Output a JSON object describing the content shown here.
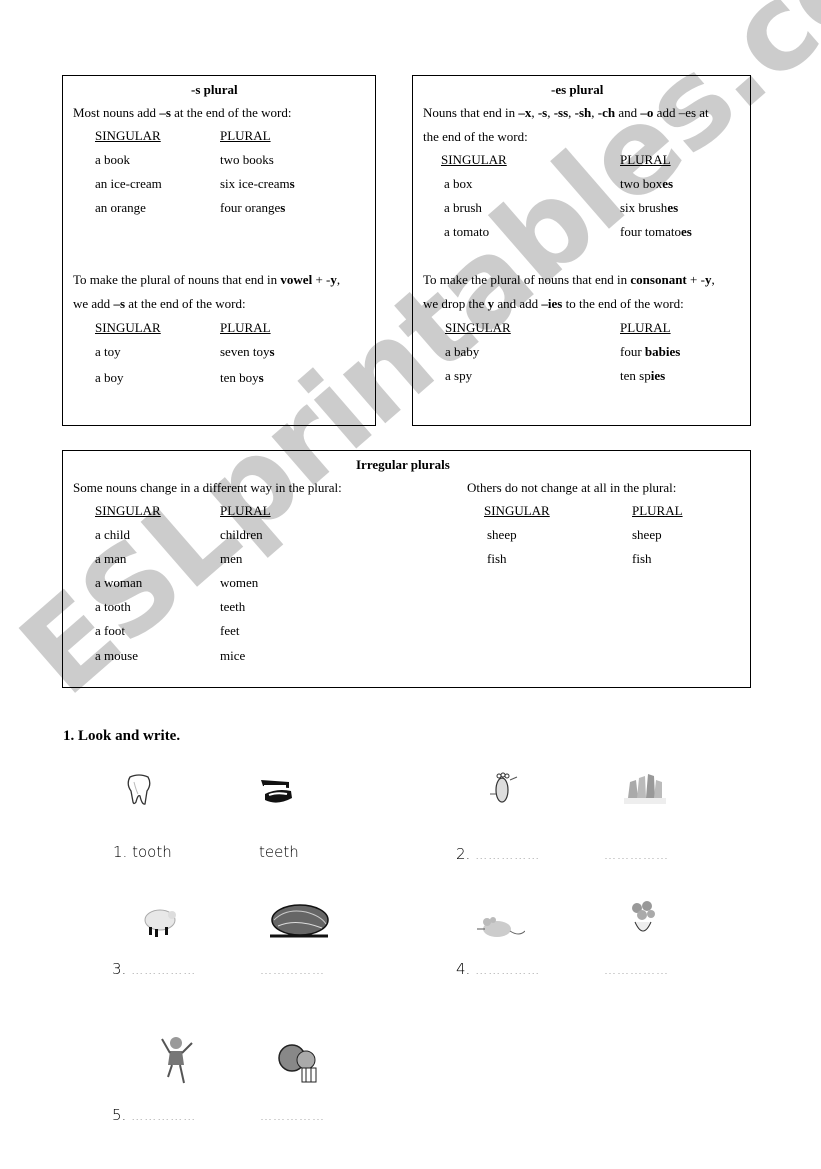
{
  "s_plural": {
    "title": "-s plural",
    "intro": [
      "Most nouns add ",
      "–s",
      " at the end of the word:"
    ],
    "headers": [
      "SINGULAR",
      "PLURAL"
    ],
    "rows": [
      {
        "singular": "a book",
        "plural_base": "two books",
        "plural_bold": ""
      },
      {
        "singular": "an ice-cream",
        "plural_base": "six ice-cream",
        "plural_bold": "s"
      },
      {
        "singular": "an orange",
        "plural_base": "four orange",
        "plural_bold": "s"
      }
    ],
    "rule2": {
      "line1": [
        "To make the plural of nouns that end in ",
        "vowel",
        " + -",
        "y",
        ","
      ],
      "line2": [
        "we add ",
        "–s",
        " at the end of the word:"
      ]
    },
    "rows2": [
      {
        "singular": "a toy",
        "plural_base": "seven toy",
        "plural_bold": "s"
      },
      {
        "singular": "a boy",
        "plural_base": "ten boy",
        "plural_bold": "s"
      }
    ]
  },
  "es_plural": {
    "title": "-es plural",
    "intro1": [
      "Nouns that end in ",
      "–x",
      ", ",
      "-s",
      ", ",
      "-ss",
      ", ",
      "-sh",
      ", ",
      "-ch",
      " and ",
      "–o",
      " add  –es at"
    ],
    "intro2": "the end of the word:",
    "headers": [
      "SINGULAR",
      "PLURAL"
    ],
    "rows": [
      {
        "singular": "a box",
        "plural_base": "two box",
        "plural_bold": "es"
      },
      {
        "singular": "a brush",
        "plural_base": "six brush",
        "plural_bold": "es"
      },
      {
        "singular": "a tomato",
        "plural_base": "four tomato",
        "plural_bold": "es"
      }
    ],
    "rule2": {
      "line1": [
        "To make the plural of nouns that end in ",
        "consonant",
        " + -",
        "y",
        ","
      ],
      "line2": [
        "we drop the ",
        "y",
        " and add ",
        "–ies",
        " to the end of the word:"
      ]
    },
    "rows2": [
      {
        "singular": "a baby",
        "plural_base": "four ",
        "plural_bold": "babies"
      },
      {
        "singular": "a spy",
        "plural_base": "ten sp",
        "plural_bold": "ies"
      }
    ]
  },
  "irregular": {
    "title": "Irregular plurals",
    "left_intro": "Some nouns change in a different way in the plural:",
    "right_intro": "Others do not change at all in the plural:",
    "headers": [
      "SINGULAR",
      "PLURAL"
    ],
    "left_rows": [
      {
        "singular": "a child",
        "plural": "children"
      },
      {
        "singular": "a man",
        "plural": "men"
      },
      {
        "singular": "a woman",
        "plural": "women"
      },
      {
        "singular": "a tooth",
        "plural": "teeth"
      },
      {
        "singular": "a foot",
        "plural": "feet"
      },
      {
        "singular": "a mouse",
        "plural": "mice"
      }
    ],
    "right_rows": [
      {
        "singular": "sheep",
        "plural": "sheep"
      },
      {
        "singular": "fish",
        "plural": "fish"
      }
    ]
  },
  "exercise": {
    "heading": "1. Look and write.",
    "items": [
      {
        "number": "1.",
        "singular": "tooth",
        "plural": "teeth",
        "pic_singular": "tooth-icon",
        "pic_plural": "teeth-icon"
      },
      {
        "number": "2.",
        "singular": "……………",
        "plural": "……………",
        "pic_singular": "foot-icon",
        "pic_plural": "feet-icon"
      },
      {
        "number": "3.",
        "singular": "……………",
        "plural": "……………",
        "pic_singular": "sheep-icon",
        "pic_plural": "sheep-flock-icon"
      },
      {
        "number": "4.",
        "singular": "……………",
        "plural": "……………",
        "pic_singular": "mouse-icon",
        "pic_plural": "mice-icon"
      },
      {
        "number": "5.",
        "singular": "……………",
        "plural": "……………",
        "pic_singular": "child-icon",
        "pic_plural": "children-icon"
      }
    ]
  },
  "watermark": "ESLprintables.com"
}
